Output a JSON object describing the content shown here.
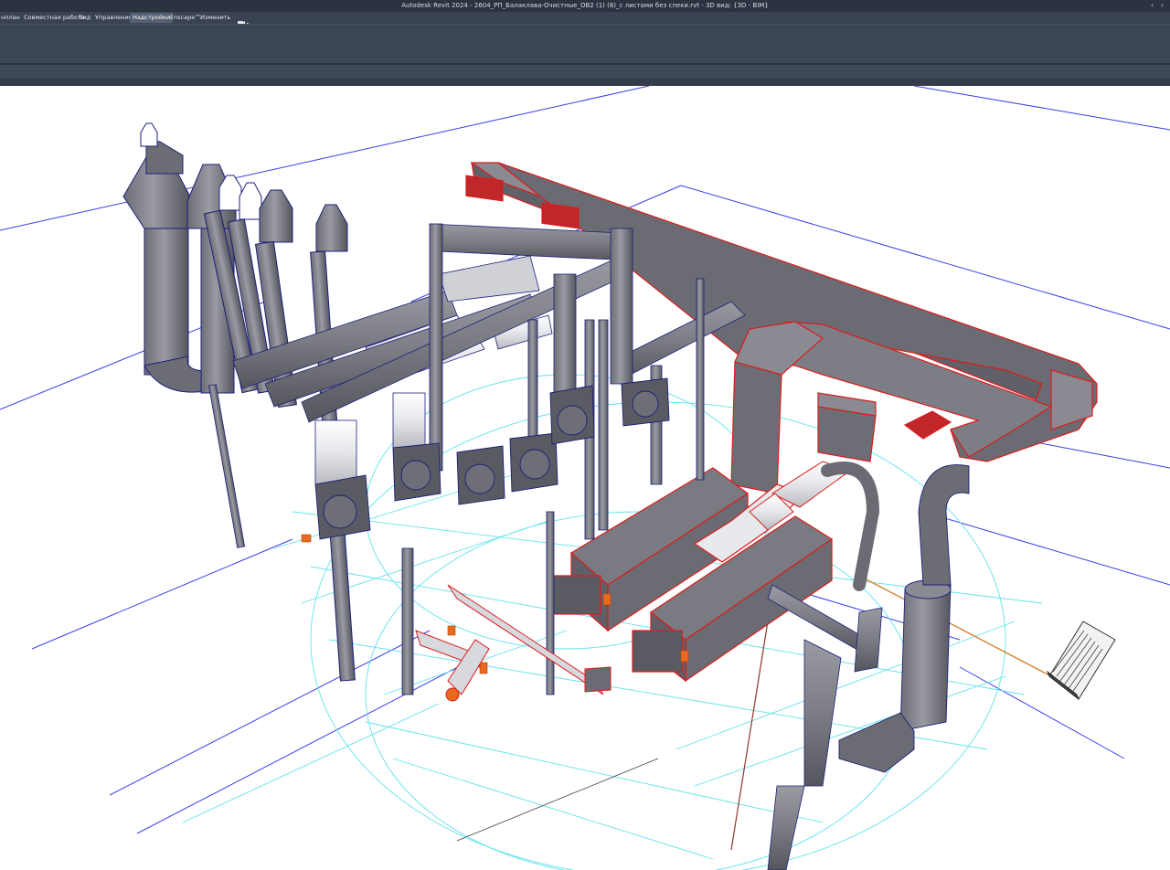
{
  "window": {
    "title": "Autodesk Revit 2024 - 2604_РП_Балаклава-Очистные_ОВ2 (1) (6)_с листами без спеки.rvt - 3D вид: {3D - BIM}",
    "minimize_symbol": "‹",
    "restore_symbol": "›"
  },
  "menu": {
    "tabs": [
      {
        "label": "нплан"
      },
      {
        "label": "Совместная работа"
      },
      {
        "label": "Вид"
      },
      {
        "label": "Управление"
      },
      {
        "label": "Надстройки"
      },
      {
        "label": "Enscape™"
      },
      {
        "label": "Изменить"
      }
    ],
    "active_tab": "Надстройки",
    "camera_dropdown_icon": "camera-icon"
  },
  "viewport": {
    "view_name": "3D - BIM",
    "background": "#ffffff",
    "colors": {
      "pipe_fill": "#7f8087",
      "pipe_dark": "#5d5e66",
      "pipe_edge": "#1c1f7a",
      "selected_edge": "#d91d1d",
      "duct_fill": "#6a6b72",
      "duct_top": "#8a8b92",
      "grid_line": "#3a3fe6",
      "hidden_line": "#5fe3ef",
      "orange_fitting": "#e86a1e"
    }
  }
}
